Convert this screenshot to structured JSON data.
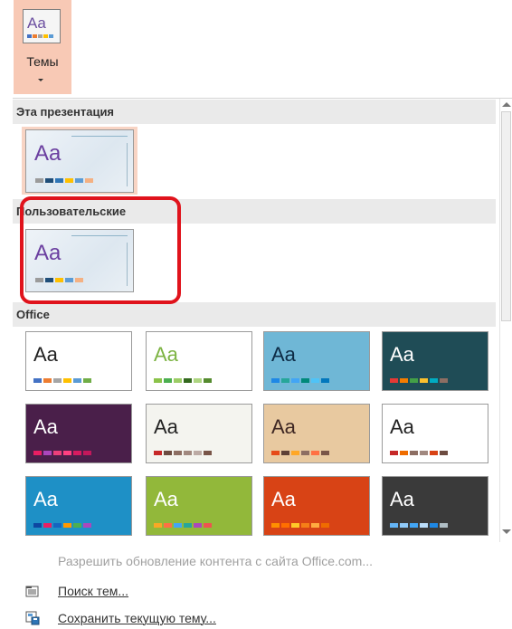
{
  "ribbon": {
    "themes_label": "Темы",
    "themes_icon_text": "Aa",
    "themes_icon_colors": [
      "#4472c4",
      "#ed7d31",
      "#a5a5a5",
      "#ffc000",
      "#5b9bd5"
    ]
  },
  "sections": {
    "this_presentation": "Эта презентация",
    "custom": "Пользовательские",
    "office": "Office"
  },
  "current_theme": {
    "label": "Aa",
    "colors": [
      "#9b9b9b",
      "#1f4e79",
      "#2e75b6",
      "#ffc000",
      "#5b9bd5",
      "#f4b183"
    ]
  },
  "custom_theme": {
    "label": "Aa",
    "colors": [
      "#9b9b9b",
      "#1f4e79",
      "#ffc000",
      "#5b9bd5",
      "#f4b183"
    ]
  },
  "office_themes": [
    {
      "label": "Aa",
      "bg": "#ffffff",
      "fg": "#222222",
      "colors": [
        "#4472c4",
        "#ed7d31",
        "#a5a5a5",
        "#ffc000",
        "#5b9bd5",
        "#70ad47"
      ]
    },
    {
      "label": "Aa",
      "bg": "#ffffff",
      "fg": "#7cb342",
      "colors": [
        "#8bc34a",
        "#4caf50",
        "#9ccc65",
        "#33691e",
        "#aed581",
        "#558b2f"
      ]
    },
    {
      "label": "Aa",
      "bg": "#6fb7d6",
      "fg": "#0d2b45",
      "colors": [
        "#1e88e5",
        "#26a69a",
        "#42a5f5",
        "#00897b",
        "#4fc3f7",
        "#0277bd"
      ]
    },
    {
      "label": "Aa",
      "bg": "#1f4c56",
      "fg": "#ffffff",
      "colors": [
        "#e53935",
        "#f57c00",
        "#43a047",
        "#fbc02d",
        "#00acc1",
        "#8d6e63"
      ]
    },
    {
      "label": "Aa",
      "bg": "#4a1f4a",
      "fg": "#ffffff",
      "colors": [
        "#e91e63",
        "#ab47bc",
        "#ec407a",
        "#ff4081",
        "#d81b60",
        "#c2185b"
      ]
    },
    {
      "label": "Aa",
      "bg": "#f4f4ef",
      "fg": "#222222",
      "colors": [
        "#c62828",
        "#6d4c41",
        "#8d6e63",
        "#a1887f",
        "#bcaaa4",
        "#795548"
      ]
    },
    {
      "label": "Aa",
      "bg": "#e8c9a0",
      "fg": "#3e2723",
      "colors": [
        "#e64a19",
        "#5d4037",
        "#ffa726",
        "#8d6e63",
        "#ff7043",
        "#795548"
      ]
    },
    {
      "label": "Aa",
      "bg": "#ffffff",
      "fg": "#222222",
      "colors": [
        "#c62828",
        "#ef6c00",
        "#8d6e63",
        "#a1887f",
        "#d84315",
        "#6d4c41"
      ]
    },
    {
      "label": "Aa",
      "bg": "#1e90c6",
      "fg": "#ffffff",
      "colors": [
        "#0d47a1",
        "#e91e63",
        "#1565c0",
        "#ff9800",
        "#4caf50",
        "#ab47bc"
      ]
    },
    {
      "label": "Aa",
      "bg": "#92b83a",
      "fg": "#ffffff",
      "colors": [
        "#f9a825",
        "#ff7043",
        "#42a5f5",
        "#26a69a",
        "#ab47bc",
        "#ef5350"
      ]
    },
    {
      "label": "Aa",
      "bg": "#d84315",
      "fg": "#ffffff",
      "colors": [
        "#ff8f00",
        "#ff6f00",
        "#ffca28",
        "#f57f17",
        "#ffab40",
        "#ef6c00"
      ]
    },
    {
      "label": "Aa",
      "bg": "#3a3a3a",
      "fg": "#ffffff",
      "colors": [
        "#64b5f6",
        "#90caf9",
        "#42a5f5",
        "#bbdefb",
        "#1e88e5",
        "#b0bec5"
      ]
    }
  ],
  "menu": {
    "allow_updates": "Разрешить обновление контента с сайта Office.com...",
    "search_themes": "Поиск тем...",
    "save_current": "Сохранить текущую тему..."
  }
}
